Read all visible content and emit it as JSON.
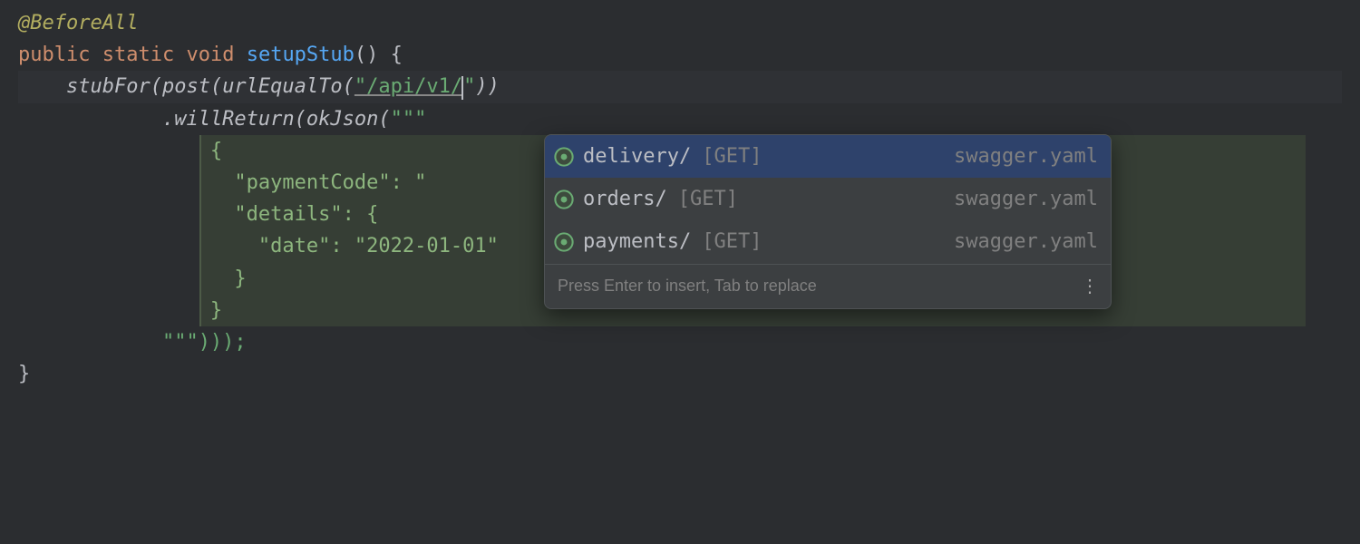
{
  "code": {
    "annotation": "@BeforeAll",
    "kw_public": "public",
    "kw_static": "static",
    "kw_void": "void",
    "method_name": "setupStub",
    "call_stubFor": "stubFor",
    "call_post": "post",
    "call_urlEqualTo": "urlEqualTo",
    "url_literal": "\"/api/v1/",
    "url_close": "\"",
    "call_willReturn": "willReturn",
    "call_okJson": "okJson",
    "triple_quote": "\"\"\"",
    "json_open": "{",
    "json_key_paymentCode": "\"paymentCode\"",
    "json_colon": ":",
    "json_val_paymentCode_partial": " \"",
    "json_key_details": "\"details\"",
    "json_key_date": "\"date\"",
    "json_val_date": "\"2022-01-01\"",
    "json_close": "}",
    "closing": "\"\"\")));",
    "brace_close": "}"
  },
  "popup": {
    "items": [
      {
        "label": "delivery/",
        "method": "[GET]",
        "source": "swagger.yaml"
      },
      {
        "label": "orders/",
        "method": "[GET]",
        "source": "swagger.yaml"
      },
      {
        "label": "payments/",
        "method": "[GET]",
        "source": "swagger.yaml"
      }
    ],
    "hint": "Press Enter to insert, Tab to replace"
  }
}
